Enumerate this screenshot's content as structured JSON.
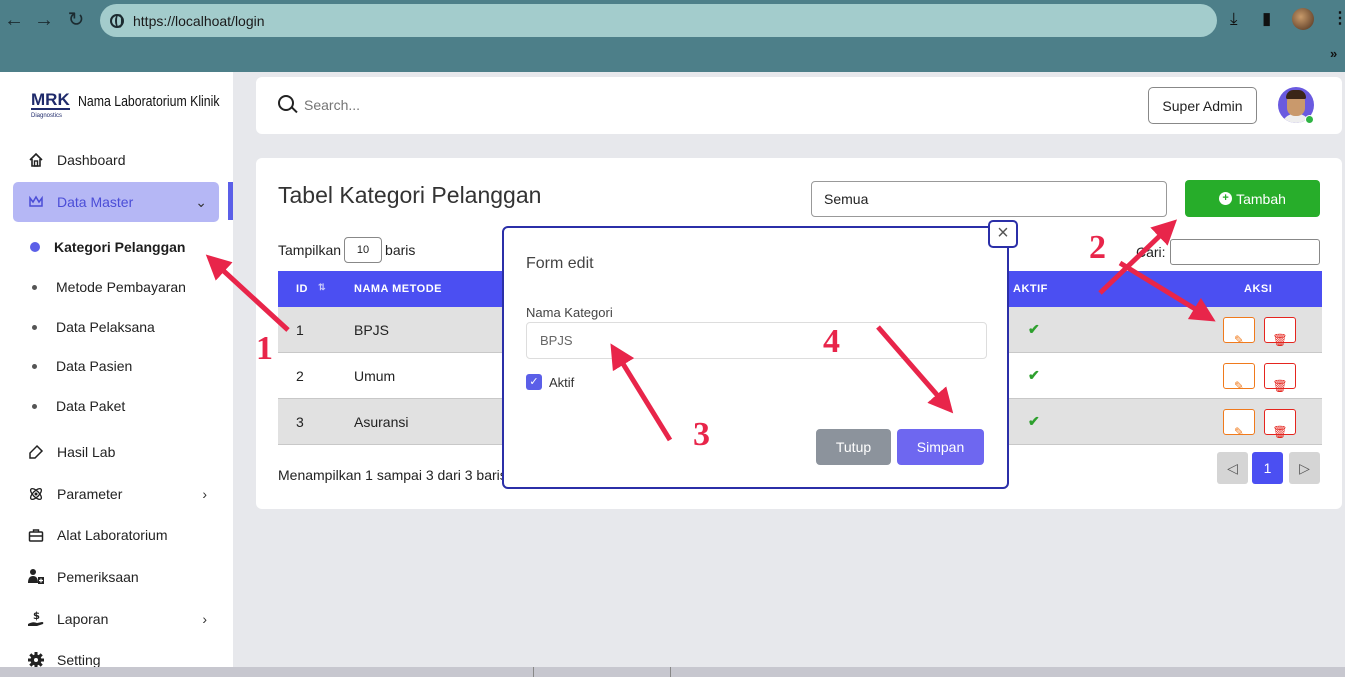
{
  "browser": {
    "url": "https://localhoat/login"
  },
  "sidebar": {
    "logo_text": "MRK",
    "logo_sub": "Diagnostics",
    "app_name": "Nama Laboratorium Klinik",
    "items": [
      {
        "label": "Dashboard",
        "icon": "home-icon"
      },
      {
        "label": "Data Master",
        "icon": "crown-icon"
      },
      {
        "label": "Hasil Lab",
        "icon": "eraser-icon"
      },
      {
        "label": "Parameter",
        "icon": "atom-icon"
      },
      {
        "label": "Alat Laboratorium",
        "icon": "briefcase-icon"
      },
      {
        "label": "Pemeriksaan",
        "icon": "user-medical-icon"
      },
      {
        "label": "Laporan",
        "icon": "hand-dollar-icon"
      },
      {
        "label": "Setting",
        "icon": "gear-icon"
      }
    ],
    "sub_items": [
      "Kategori Pelanggan",
      "Metode Pembayaran",
      "Data Pelaksana",
      "Data Pasien",
      "Data Paket"
    ]
  },
  "header": {
    "search_placeholder": "Search...",
    "user_label": "Super Admin"
  },
  "main": {
    "title": "Tabel Kategori Pelanggan",
    "filter_value": "Semua",
    "add_button": "Tambah",
    "show_prefix": "Tampilkan",
    "show_count": "10",
    "show_suffix": "baris",
    "search_label": "Cari:",
    "columns": [
      "ID",
      "NAMA METODE",
      "AKTIF",
      "AKSI"
    ],
    "rows": [
      {
        "id": "1",
        "name": "BPJS"
      },
      {
        "id": "2",
        "name": "Umum"
      },
      {
        "id": "3",
        "name": "Asuransi"
      }
    ],
    "info": "Menampilkan 1 sampai 3 dari 3 baris",
    "current_page": "1"
  },
  "modal": {
    "title": "Form edit",
    "field_label": "Nama Kategori",
    "field_value": "BPJS",
    "checkbox_label": "Aktif",
    "close_label": "Tutup",
    "save_label": "Simpan"
  },
  "annotations": [
    "1",
    "2",
    "3",
    "4"
  ],
  "colors": {
    "primary": "#4b4ff2",
    "success": "#27ad2a",
    "annotation": "#e8254a",
    "modal_border": "#2b2fa8"
  }
}
